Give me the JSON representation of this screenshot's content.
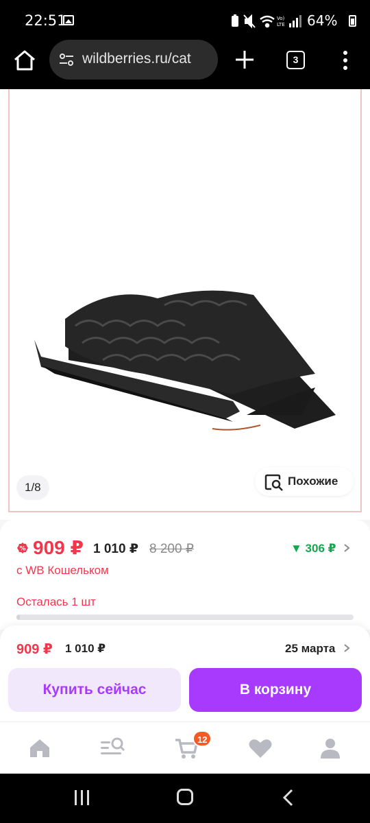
{
  "status_bar": {
    "time": "22:51",
    "battery": "64%",
    "icons": [
      "image-icon",
      "battery-saver-icon",
      "mute-icon",
      "wifi-icon",
      "volte-icon",
      "signal-icon",
      "battery-icon"
    ]
  },
  "browser": {
    "url": "wildberries.ru/cat",
    "tab_count": "3"
  },
  "product": {
    "image_counter": "1/8",
    "similar_label": "Похожие",
    "price": "909 ₽",
    "price_before_wallet": "1 010 ₽",
    "price_original": "8 200 ₽",
    "points": "▼ 306 ₽",
    "wallet_label": "с WB Кошельком",
    "stock_label": "Осталась 1 шт",
    "stock_remaining_fraction": 0.01
  },
  "purchase_bar": {
    "price": "909 ₽",
    "price_old": "1 010 ₽",
    "delivery_date": "25 марта",
    "buy_now_label": "Купить сейчас",
    "add_to_cart_label": "В корзину"
  },
  "bottom_nav": {
    "items": [
      "home-icon",
      "catalog-search-icon",
      "cart-icon",
      "favorites-icon",
      "profile-icon"
    ],
    "cart_count": "12"
  },
  "colors": {
    "accent_purple": "#a73afd",
    "price_red": "#f2364c",
    "points_green": "#0eaa4c",
    "badge_orange": "#f55a24"
  }
}
